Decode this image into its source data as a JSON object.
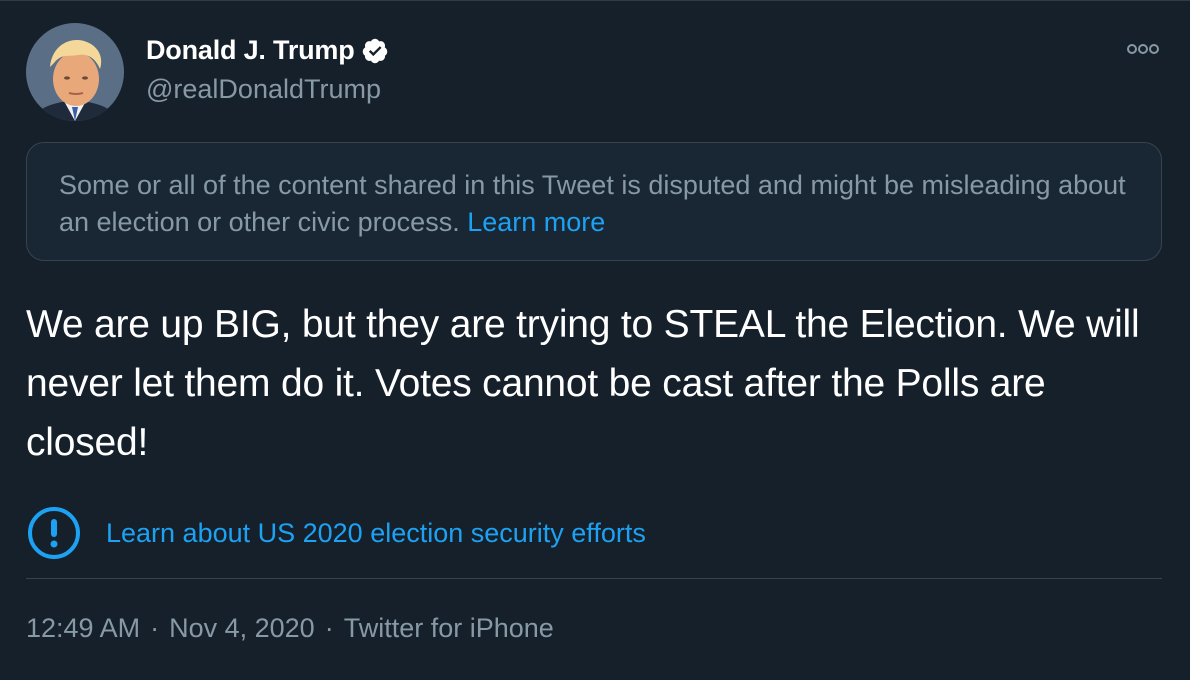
{
  "author": {
    "display_name": "Donald J. Trump",
    "handle": "@realDonaldTrump",
    "verified": true
  },
  "icons": {
    "verified": "verified-badge-icon",
    "more": "more-options-icon",
    "alert": "alert-circle-icon"
  },
  "disputed_notice": {
    "text": "Some or all of the content shared in this Tweet is disputed and might be misleading about an election or other civic process. ",
    "link_label": "Learn more"
  },
  "tweet": {
    "text": "We are up BIG, but they are trying to STEAL the Election. We will never let them do it. Votes cannot be cast after the Polls are closed!"
  },
  "election_link": {
    "label": "Learn about US 2020 election security efforts"
  },
  "meta": {
    "time": "12:49 AM",
    "date": "Nov 4, 2020",
    "source": "Twitter for iPhone",
    "separator": "·"
  },
  "colors": {
    "background": "#15202b",
    "accent": "#1da1f2",
    "secondary_text": "#8899a6",
    "border": "#38444d"
  }
}
